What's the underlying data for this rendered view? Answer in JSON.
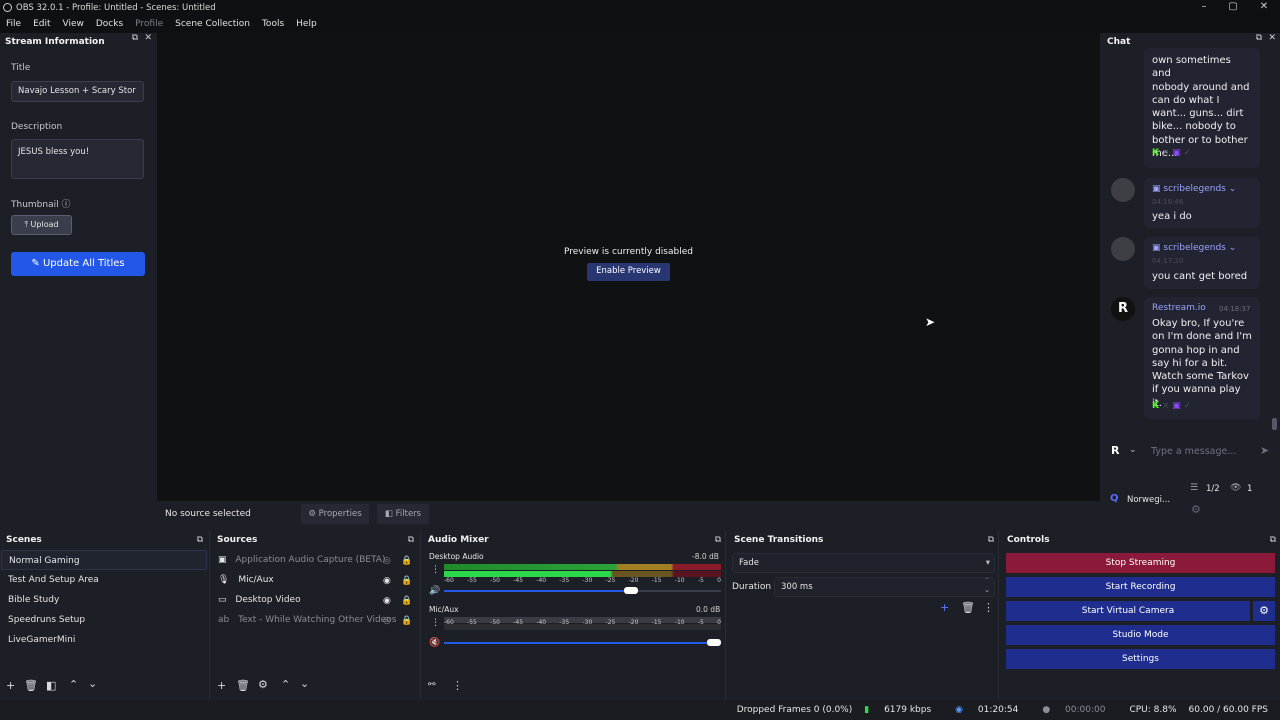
{
  "window": {
    "title": "OBS 32.0.1 - Profile: Untitled - Scenes: Untitled"
  },
  "menu": [
    "File",
    "Edit",
    "View",
    "Docks",
    "Profile",
    "Scene Collection",
    "Tools",
    "Help"
  ],
  "stream_info": {
    "header": "Stream Information",
    "title_label": "Title",
    "title_value": "Navajo Lesson + Scary Stor",
    "description_label": "Description",
    "description_value": "JESUS bless you!",
    "thumbnail_label": "Thumbnail",
    "upload_label": "Upload",
    "update_button": "Update All Titles"
  },
  "preview": {
    "disabled_text": "Preview is currently disabled",
    "enable_button": "Enable Preview",
    "no_source": "No source selected",
    "properties": "Properties",
    "filters": "Filters"
  },
  "chat": {
    "header": "Chat",
    "messages": [
      {
        "text": [
          "own sometimes and",
          "nobody around and",
          "can do what I",
          "want... guns... dirt",
          "bike... nobody to",
          "bother or to bother",
          "me..."
        ]
      },
      {
        "user": "scribelegends",
        "time": "04:16:46",
        "text": [
          "yea i do"
        ]
      },
      {
        "user": "scribelegends",
        "time": "04:17:20",
        "text": [
          "you cant get bored"
        ]
      },
      {
        "user": "Restream.io",
        "time": "04:18:37",
        "text": [
          "Okay bro, If you're",
          "on I'm done and I'm",
          "gonna hop in and",
          "say hi for a bit.",
          "Watch some Tarkov",
          "if you wanna play it."
        ]
      }
    ],
    "placeholder": "Type a message...",
    "channel": "Norwegi...",
    "viewer_ratio": "1/2",
    "viewers": "1"
  },
  "scenes": {
    "title": "Scenes",
    "items": [
      "Normal Gaming",
      "Test And Setup Area",
      "Bible Study",
      "Speedruns Setup",
      "LiveGamerMini"
    ]
  },
  "sources": {
    "title": "Sources",
    "items": [
      {
        "label": "Application Audio Capture (BETA)",
        "icon": "speaker-icon"
      },
      {
        "label": "Mic/Aux",
        "icon": "mic-icon"
      },
      {
        "label": "Desktop Video",
        "icon": "monitor-icon"
      },
      {
        "label": "Text - While Watching Other Videos",
        "icon": "text-icon"
      }
    ]
  },
  "audio_mixer": {
    "title": "Audio Mixer",
    "channels": [
      {
        "name": "Desktop Audio",
        "db": "-8.0 dB",
        "volume_level": 0.7
      },
      {
        "name": "Mic/Aux",
        "db": "0.0 dB",
        "volume_level": 1.0
      }
    ],
    "ticks": [
      "-60",
      "-55",
      "-50",
      "-45",
      "-40",
      "-35",
      "-30",
      "-25",
      "-20",
      "-15",
      "-10",
      "-5",
      "0"
    ]
  },
  "transitions": {
    "title": "Scene Transitions",
    "selected": "Fade",
    "duration_label": "Duration",
    "duration_value": "300 ms"
  },
  "controls": {
    "title": "Controls",
    "stop_streaming": "Stop Streaming",
    "start_recording": "Start Recording",
    "start_virtual_camera": "Start Virtual Camera",
    "studio_mode": "Studio Mode",
    "settings": "Settings"
  },
  "status": {
    "dropped": "Dropped Frames 0 (0.0%)",
    "kbps": "6179 kbps",
    "stream_time": "01:20:54",
    "rec_time": "00:00:00",
    "cpu": "CPU: 8.8%",
    "fps": "60.00 / 60.00 FPS"
  },
  "colors": {
    "accent_blue": "#2357e8",
    "stop_red": "#8b1a3a",
    "control_blue": "#1f2e8e"
  }
}
